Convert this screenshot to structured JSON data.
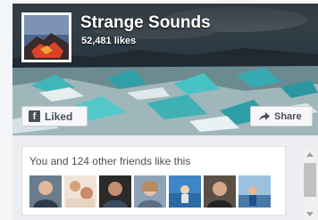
{
  "page": {
    "name": "Strange Sounds",
    "likes": "52,481 likes"
  },
  "buttons": {
    "liked_label": "Liked",
    "share_label": "Share",
    "liked_icon": "facebook-f-icon",
    "share_icon": "share-arrow-icon"
  },
  "friends": {
    "text": "You and 124 other friends like this",
    "faces": [
      {
        "name": "friend-avatar-1"
      },
      {
        "name": "friend-avatar-2"
      },
      {
        "name": "friend-avatar-3"
      },
      {
        "name": "friend-avatar-4"
      },
      {
        "name": "friend-avatar-5"
      },
      {
        "name": "friend-avatar-6"
      },
      {
        "name": "friend-avatar-7"
      }
    ]
  },
  "colors": {
    "button_bg": "#f6f7f9",
    "button_text": "#4b4f56",
    "panel_bg": "#ffffff"
  }
}
